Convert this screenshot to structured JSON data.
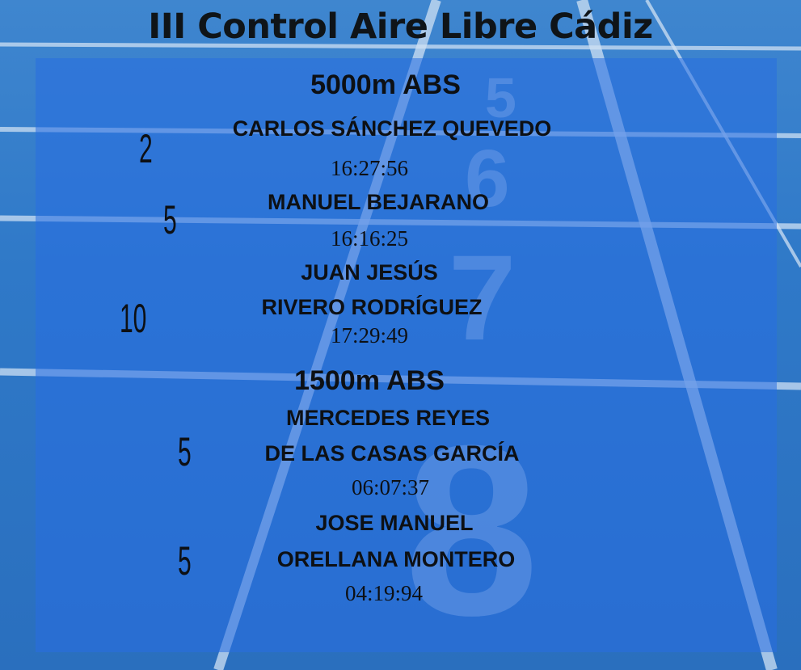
{
  "title": "III Control Aire Libre Cádiz",
  "events": [
    {
      "heading": "5000m ABS",
      "results": [
        {
          "position": "2",
          "name_lines": [
            "CARLOS SÁNCHEZ QUEVEDO"
          ],
          "time": "16:27:56"
        },
        {
          "position": "5",
          "name_lines": [
            "MANUEL BEJARANO"
          ],
          "time": "16:16:25"
        },
        {
          "position": "10",
          "name_lines": [
            "JUAN JESÚS",
            "RIVERO RODRÍGUEZ"
          ],
          "time": "17:29:49"
        }
      ]
    },
    {
      "heading": "1500m ABS",
      "results": [
        {
          "position": "5",
          "name_lines": [
            "MERCEDES REYES",
            "DE LAS CASAS GARCÍA"
          ],
          "time": "06:07:37"
        },
        {
          "position": "5",
          "name_lines": [
            "JOSE MANUEL",
            "ORELLANA MONTERO"
          ],
          "time": "04:19:94"
        }
      ]
    }
  ]
}
